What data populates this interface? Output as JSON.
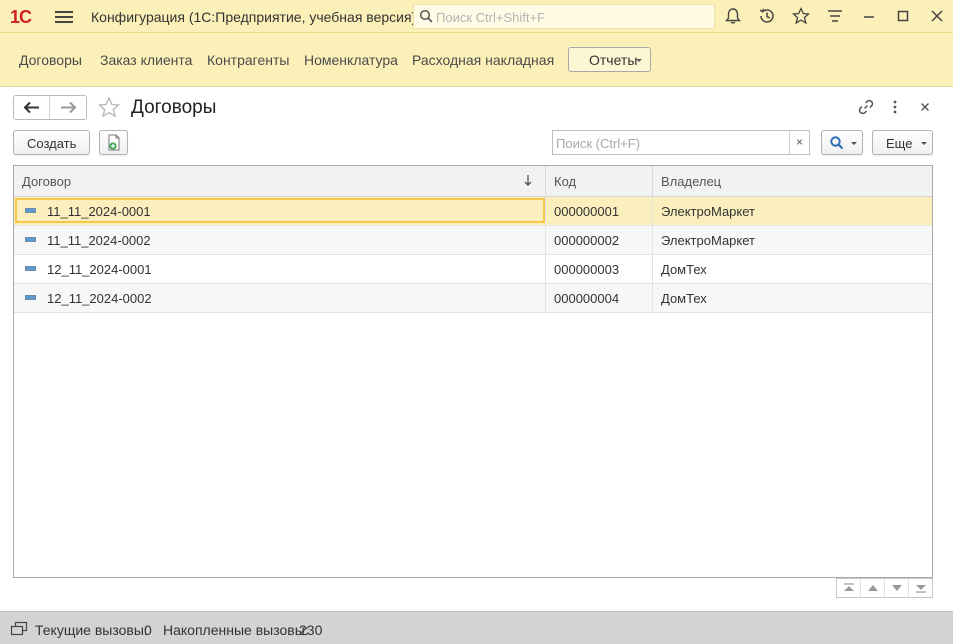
{
  "app": {
    "logo": "1С",
    "title": "Конфигурация  (1С:Предприятие, учебная версия)",
    "search_placeholder": "Поиск Ctrl+Shift+F"
  },
  "titlebar_icons": [
    "bell-icon",
    "history-icon",
    "star-icon",
    "menu-lines-icon",
    "minimize-icon",
    "maximize-icon",
    "close-icon"
  ],
  "sections": {
    "items": [
      "Договоры",
      "Заказ клиента",
      "Контрагенты",
      "Номенклатура",
      "Расходная накладная"
    ],
    "reports_label": "Отчеты"
  },
  "form": {
    "title": "Договоры",
    "create_label": "Создать",
    "search_placeholder": "Поиск (Ctrl+F)",
    "search_clear": "×",
    "more_label": "Еще"
  },
  "table": {
    "columns": [
      "Договор",
      "Код",
      "Владелец"
    ],
    "sort_indicator": "↓",
    "rows": [
      {
        "contract": "11_11_2024-0001",
        "code": "000000001",
        "owner": "ЭлектроМаркет"
      },
      {
        "contract": "11_11_2024-0002",
        "code": "000000002",
        "owner": "ЭлектроМаркет"
      },
      {
        "contract": "12_11_2024-0001",
        "code": "000000003",
        "owner": "ДомТех"
      },
      {
        "contract": "12_11_2024-0002",
        "code": "000000004",
        "owner": "ДомТех"
      }
    ],
    "selected_row": 0
  },
  "status": {
    "current_calls_label": "Текущие вызовы:",
    "current_calls": "0",
    "accumulated_calls_label": "Накопленные вызовы:",
    "accumulated_calls": "230"
  },
  "colors": {
    "panel": "#fbf1b8",
    "selected_row": "#fbf0bd",
    "focus_border": "#f4c94a",
    "logo_red": "#d11f26"
  }
}
